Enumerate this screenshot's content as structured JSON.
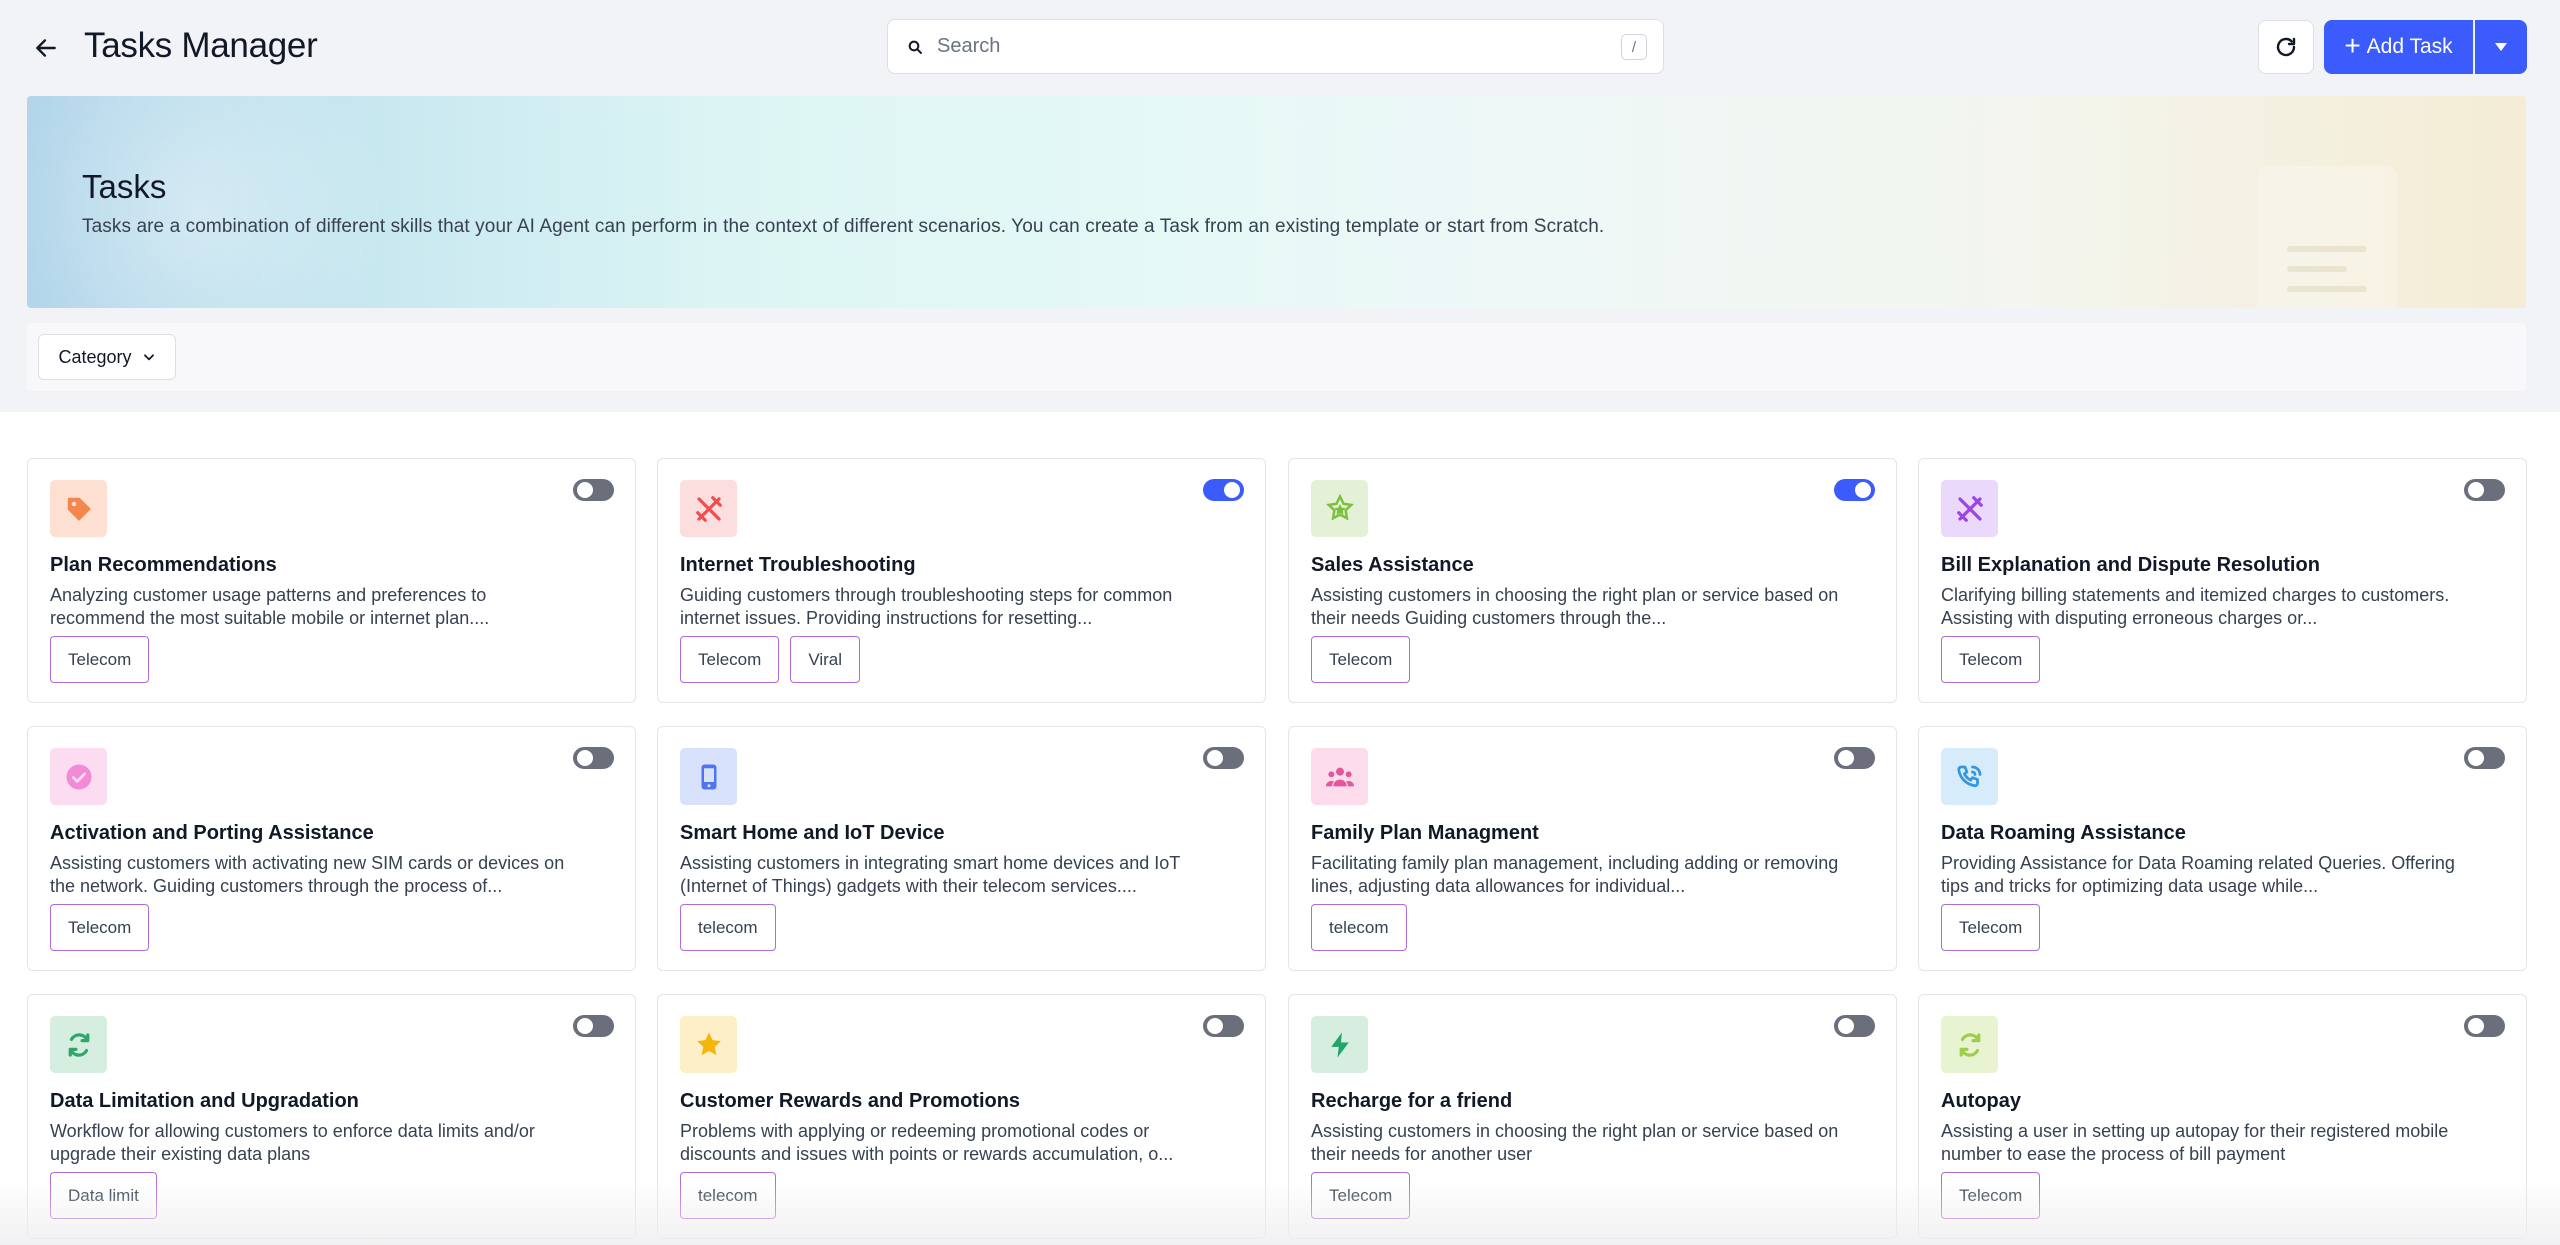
{
  "header": {
    "back_icon": "arrow-left-icon",
    "title": "Tasks Manager",
    "search": {
      "placeholder": "Search",
      "shortcut": "/"
    },
    "refresh_icon": "refresh-icon",
    "add_button_label": "Add Task",
    "add_button_icon": "plus-icon",
    "dropdown_icon": "caret-down-icon"
  },
  "banner": {
    "title": "Tasks",
    "description": "Tasks are a combination of different skills that your AI Agent can perform in the context of different scenarios. You can create a Task from an existing template or start from Scratch."
  },
  "filters": {
    "category_label": "Category"
  },
  "colors": {
    "accent": "#3b5bfd",
    "tag_border": "#b06ad9",
    "toggle_off": "#6b6f7b"
  },
  "cards": [
    {
      "title": "Plan Recommendations",
      "description": "Analyzing customer usage patterns and preferences to recommend the most suitable mobile or internet plan....",
      "tags": [
        "Telecom"
      ],
      "enabled": false,
      "icon": "tag-icon",
      "icon_bg": "#fde0d2",
      "icon_color": "#f4874b"
    },
    {
      "title": "Internet Troubleshooting",
      "description": "Guiding customers through troubleshooting steps for common internet issues. Providing instructions for resetting...",
      "tags": [
        "Telecom",
        "Viral"
      ],
      "enabled": true,
      "icon": "tools-icon",
      "icon_bg": "#fddede",
      "icon_color": "#ef4f4f"
    },
    {
      "title": "Sales Assistance",
      "description": "Assisting customers in choosing the right plan or service based on their needs Guiding customers through the...",
      "tags": [
        "Telecom"
      ],
      "enabled": true,
      "icon": "star-badge-icon",
      "icon_bg": "#e4f1d6",
      "icon_color": "#7cbf3e"
    },
    {
      "title": "Bill Explanation and Dispute Resolution",
      "description": "Clarifying billing statements and itemized charges to customers. Assisting with disputing erroneous charges or...",
      "tags": [
        "Telecom"
      ],
      "enabled": false,
      "icon": "tools-icon",
      "icon_bg": "#ead9fb",
      "icon_color": "#9b45e6"
    },
    {
      "title": "Activation and Porting Assistance",
      "description": "Assisting customers with activating new SIM cards or devices on the network. Guiding customers through the process of...",
      "tags": [
        "Telecom"
      ],
      "enabled": false,
      "icon": "check-circle-icon",
      "icon_bg": "#fbdcf1",
      "icon_color": "#f28ad6"
    },
    {
      "title": "Smart Home and IoT Device",
      "description": "Assisting customers in integrating smart home devices and IoT (Internet of Things) gadgets with their telecom services....",
      "tags": [
        "telecom"
      ],
      "enabled": false,
      "icon": "mobile-icon",
      "icon_bg": "#d9e2fc",
      "icon_color": "#4f74f2"
    },
    {
      "title": "Family Plan Managment",
      "description": "Facilitating family plan management, including adding or removing lines, adjusting data allowances for individual...",
      "tags": [
        "telecom"
      ],
      "enabled": false,
      "icon": "users-icon",
      "icon_bg": "#fcdceb",
      "icon_color": "#e5559b"
    },
    {
      "title": "Data Roaming Assistance",
      "description": "Providing Assistance for Data Roaming related Queries. Offering tips and tricks for optimizing data usage while...",
      "tags": [
        "Telecom"
      ],
      "enabled": false,
      "icon": "phone-call-icon",
      "icon_bg": "#d7ecfb",
      "icon_color": "#3596e0"
    },
    {
      "title": "Data Limitation and Upgradation",
      "description": "Workflow for allowing customers to enforce data limits and/or upgrade their existing data plans",
      "tags": [
        "Data limit"
      ],
      "enabled": false,
      "icon": "sync-icon",
      "icon_bg": "#d5eee0",
      "icon_color": "#2fa56b"
    },
    {
      "title": "Customer Rewards and Promotions",
      "description": "Problems with applying or redeeming promotional codes or discounts and issues with points or rewards accumulation, o...",
      "tags": [
        "telecom"
      ],
      "enabled": false,
      "icon": "star-icon",
      "icon_bg": "#fdf0c8",
      "icon_color": "#f5b50a"
    },
    {
      "title": "Recharge for a friend",
      "description": "Assisting customers in choosing the right plan or service based on their needs for another user",
      "tags": [
        "Telecom"
      ],
      "enabled": false,
      "icon": "bolt-icon",
      "icon_bg": "#d5eee0",
      "icon_color": "#21a568"
    },
    {
      "title": "Autopay",
      "description": "Assisting a user in setting up autopay for their registered mobile number to ease the process of bill payment",
      "tags": [
        "Telecom"
      ],
      "enabled": false,
      "icon": "sync-icon",
      "icon_bg": "#e8f3d2",
      "icon_color": "#9bcf4a"
    }
  ]
}
